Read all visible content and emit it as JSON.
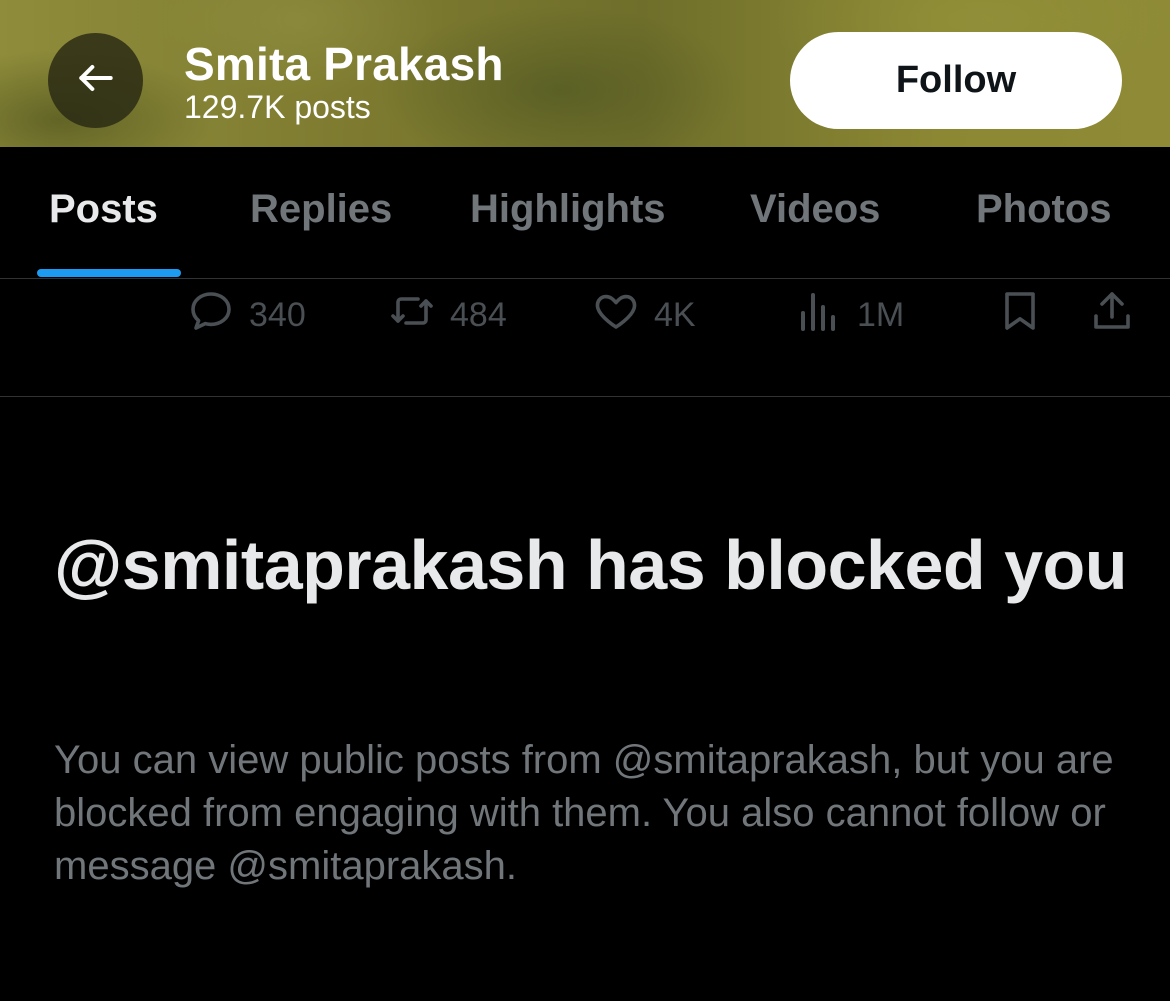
{
  "header": {
    "name": "Smita Prakash",
    "posts_count": "129.7K posts",
    "follow_label": "Follow"
  },
  "tabs": [
    {
      "label": "Posts",
      "active": true
    },
    {
      "label": "Replies",
      "active": false
    },
    {
      "label": "Highlights",
      "active": false
    },
    {
      "label": "Videos",
      "active": false
    },
    {
      "label": "Photos",
      "active": false
    }
  ],
  "actions": {
    "replies": "340",
    "reposts": "484",
    "likes": "4K",
    "views": "1M"
  },
  "blocked": {
    "title": "@smitaprakash has blocked you",
    "body": "You can view public posts from @smitaprakash, but you are blocked from engaging with them. You also cannot follow or message @smitaprakash."
  },
  "colors": {
    "accent": "#1d9bf0",
    "text_primary": "#e7e9ea",
    "text_secondary": "#71767b",
    "background": "#000000"
  },
  "icons": [
    "back-arrow-icon",
    "reply-icon",
    "repost-icon",
    "like-icon",
    "views-icon",
    "bookmark-icon",
    "share-icon"
  ]
}
